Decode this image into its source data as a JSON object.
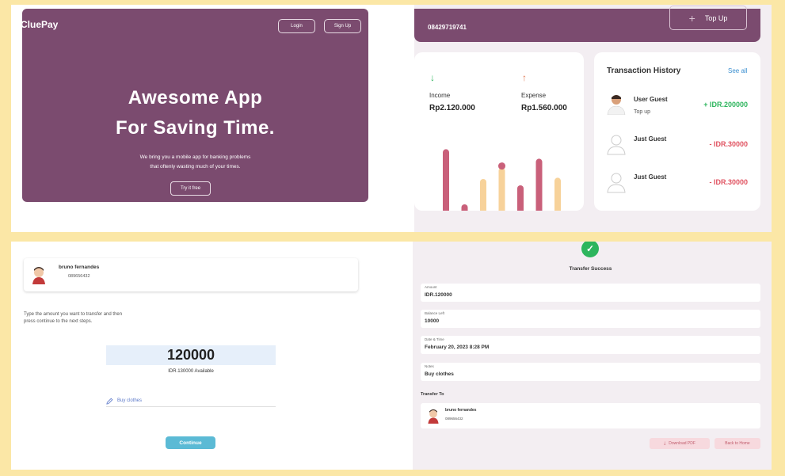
{
  "landing": {
    "logo": "CluePay",
    "login": "Login",
    "signup": "Sign Up",
    "title_line1": "Awesome App",
    "title_line2": "For Saving Time.",
    "subtitle_line1": "We bring you a mobile app for banking problems",
    "subtitle_line2": "that oftenly wasting much of your times.",
    "cta": "Try it free"
  },
  "dashboard": {
    "account_number": "08429719741",
    "topup_label": "Top Up",
    "income_label": "Income",
    "income_amount": "Rp2.120.000",
    "expense_label": "Expense",
    "expense_amount": "Rp1.560.000",
    "history_title": "Transaction History",
    "see_all": "See all",
    "transactions": [
      {
        "name": "User Guest",
        "sub": "Top up",
        "amount": "+ IDR.200000"
      },
      {
        "name": "Just Guest",
        "sub": "",
        "amount": "- IDR.30000"
      },
      {
        "name": "Just Guest",
        "sub": "",
        "amount": "- IDR.30000"
      }
    ],
    "colors": {
      "brand": "#7b4b6f",
      "income": "#2db55d",
      "expense": "#e05260",
      "bar_dark": "#c9607a",
      "bar_light": "#f7d29a"
    }
  },
  "chart_data": {
    "type": "bar",
    "categories": [
      "",
      "",
      "",
      "",
      "",
      "",
      "",
      ""
    ],
    "values": [
      0.97,
      0.1,
      0.5,
      0.68,
      0.4,
      0.82,
      0.52
    ],
    "value_unit": "fraction of chart height",
    "bar_colors": [
      "#c9607a",
      "#c9607a",
      "#f7d29a",
      "#f7d29a",
      "#c9607a",
      "#c9607a",
      "#f7d29a"
    ],
    "dot_on_bar": 3,
    "title": "",
    "xlabel": "",
    "ylabel": ""
  },
  "transfer": {
    "recipient_name": "bruno fernandes",
    "recipient_phone": "089656432",
    "instruction_line1": "Type the amount you want to transfer and then",
    "instruction_line2": "press continue to the next steps.",
    "amount": "120000",
    "available": "IDR.130000 Available",
    "notes": "Buy clothes",
    "continue": "Continue"
  },
  "success": {
    "title": "Transfer Success",
    "fields": [
      {
        "label": "Amount",
        "value": "IDR.120000"
      },
      {
        "label": "Balance Left",
        "value": "10000"
      },
      {
        "label": "Date & Time",
        "value": "February 20, 2023 8:28 PM"
      },
      {
        "label": "Notes",
        "value": "Buy clothes"
      }
    ],
    "transfer_to": "Transfer To",
    "recipient_name": "bruno fernandes",
    "recipient_phone": "089656432",
    "download_pdf": "Download PDF",
    "back_home": "Back to Home"
  }
}
